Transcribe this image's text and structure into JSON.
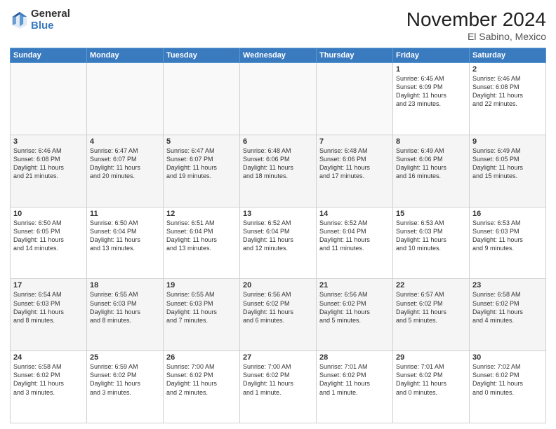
{
  "logo": {
    "general": "General",
    "blue": "Blue"
  },
  "title": "November 2024",
  "location": "El Sabino, Mexico",
  "weekdays": [
    "Sunday",
    "Monday",
    "Tuesday",
    "Wednesday",
    "Thursday",
    "Friday",
    "Saturday"
  ],
  "weeks": [
    [
      {
        "day": "",
        "info": ""
      },
      {
        "day": "",
        "info": ""
      },
      {
        "day": "",
        "info": ""
      },
      {
        "day": "",
        "info": ""
      },
      {
        "day": "",
        "info": ""
      },
      {
        "day": "1",
        "info": "Sunrise: 6:45 AM\nSunset: 6:09 PM\nDaylight: 11 hours\nand 23 minutes."
      },
      {
        "day": "2",
        "info": "Sunrise: 6:46 AM\nSunset: 6:08 PM\nDaylight: 11 hours\nand 22 minutes."
      }
    ],
    [
      {
        "day": "3",
        "info": "Sunrise: 6:46 AM\nSunset: 6:08 PM\nDaylight: 11 hours\nand 21 minutes."
      },
      {
        "day": "4",
        "info": "Sunrise: 6:47 AM\nSunset: 6:07 PM\nDaylight: 11 hours\nand 20 minutes."
      },
      {
        "day": "5",
        "info": "Sunrise: 6:47 AM\nSunset: 6:07 PM\nDaylight: 11 hours\nand 19 minutes."
      },
      {
        "day": "6",
        "info": "Sunrise: 6:48 AM\nSunset: 6:06 PM\nDaylight: 11 hours\nand 18 minutes."
      },
      {
        "day": "7",
        "info": "Sunrise: 6:48 AM\nSunset: 6:06 PM\nDaylight: 11 hours\nand 17 minutes."
      },
      {
        "day": "8",
        "info": "Sunrise: 6:49 AM\nSunset: 6:06 PM\nDaylight: 11 hours\nand 16 minutes."
      },
      {
        "day": "9",
        "info": "Sunrise: 6:49 AM\nSunset: 6:05 PM\nDaylight: 11 hours\nand 15 minutes."
      }
    ],
    [
      {
        "day": "10",
        "info": "Sunrise: 6:50 AM\nSunset: 6:05 PM\nDaylight: 11 hours\nand 14 minutes."
      },
      {
        "day": "11",
        "info": "Sunrise: 6:50 AM\nSunset: 6:04 PM\nDaylight: 11 hours\nand 13 minutes."
      },
      {
        "day": "12",
        "info": "Sunrise: 6:51 AM\nSunset: 6:04 PM\nDaylight: 11 hours\nand 13 minutes."
      },
      {
        "day": "13",
        "info": "Sunrise: 6:52 AM\nSunset: 6:04 PM\nDaylight: 11 hours\nand 12 minutes."
      },
      {
        "day": "14",
        "info": "Sunrise: 6:52 AM\nSunset: 6:04 PM\nDaylight: 11 hours\nand 11 minutes."
      },
      {
        "day": "15",
        "info": "Sunrise: 6:53 AM\nSunset: 6:03 PM\nDaylight: 11 hours\nand 10 minutes."
      },
      {
        "day": "16",
        "info": "Sunrise: 6:53 AM\nSunset: 6:03 PM\nDaylight: 11 hours\nand 9 minutes."
      }
    ],
    [
      {
        "day": "17",
        "info": "Sunrise: 6:54 AM\nSunset: 6:03 PM\nDaylight: 11 hours\nand 8 minutes."
      },
      {
        "day": "18",
        "info": "Sunrise: 6:55 AM\nSunset: 6:03 PM\nDaylight: 11 hours\nand 8 minutes."
      },
      {
        "day": "19",
        "info": "Sunrise: 6:55 AM\nSunset: 6:03 PM\nDaylight: 11 hours\nand 7 minutes."
      },
      {
        "day": "20",
        "info": "Sunrise: 6:56 AM\nSunset: 6:02 PM\nDaylight: 11 hours\nand 6 minutes."
      },
      {
        "day": "21",
        "info": "Sunrise: 6:56 AM\nSunset: 6:02 PM\nDaylight: 11 hours\nand 5 minutes."
      },
      {
        "day": "22",
        "info": "Sunrise: 6:57 AM\nSunset: 6:02 PM\nDaylight: 11 hours\nand 5 minutes."
      },
      {
        "day": "23",
        "info": "Sunrise: 6:58 AM\nSunset: 6:02 PM\nDaylight: 11 hours\nand 4 minutes."
      }
    ],
    [
      {
        "day": "24",
        "info": "Sunrise: 6:58 AM\nSunset: 6:02 PM\nDaylight: 11 hours\nand 3 minutes."
      },
      {
        "day": "25",
        "info": "Sunrise: 6:59 AM\nSunset: 6:02 PM\nDaylight: 11 hours\nand 3 minutes."
      },
      {
        "day": "26",
        "info": "Sunrise: 7:00 AM\nSunset: 6:02 PM\nDaylight: 11 hours\nand 2 minutes."
      },
      {
        "day": "27",
        "info": "Sunrise: 7:00 AM\nSunset: 6:02 PM\nDaylight: 11 hours\nand 1 minute."
      },
      {
        "day": "28",
        "info": "Sunrise: 7:01 AM\nSunset: 6:02 PM\nDaylight: 11 hours\nand 1 minute."
      },
      {
        "day": "29",
        "info": "Sunrise: 7:01 AM\nSunset: 6:02 PM\nDaylight: 11 hours\nand 0 minutes."
      },
      {
        "day": "30",
        "info": "Sunrise: 7:02 AM\nSunset: 6:02 PM\nDaylight: 11 hours\nand 0 minutes."
      }
    ]
  ]
}
